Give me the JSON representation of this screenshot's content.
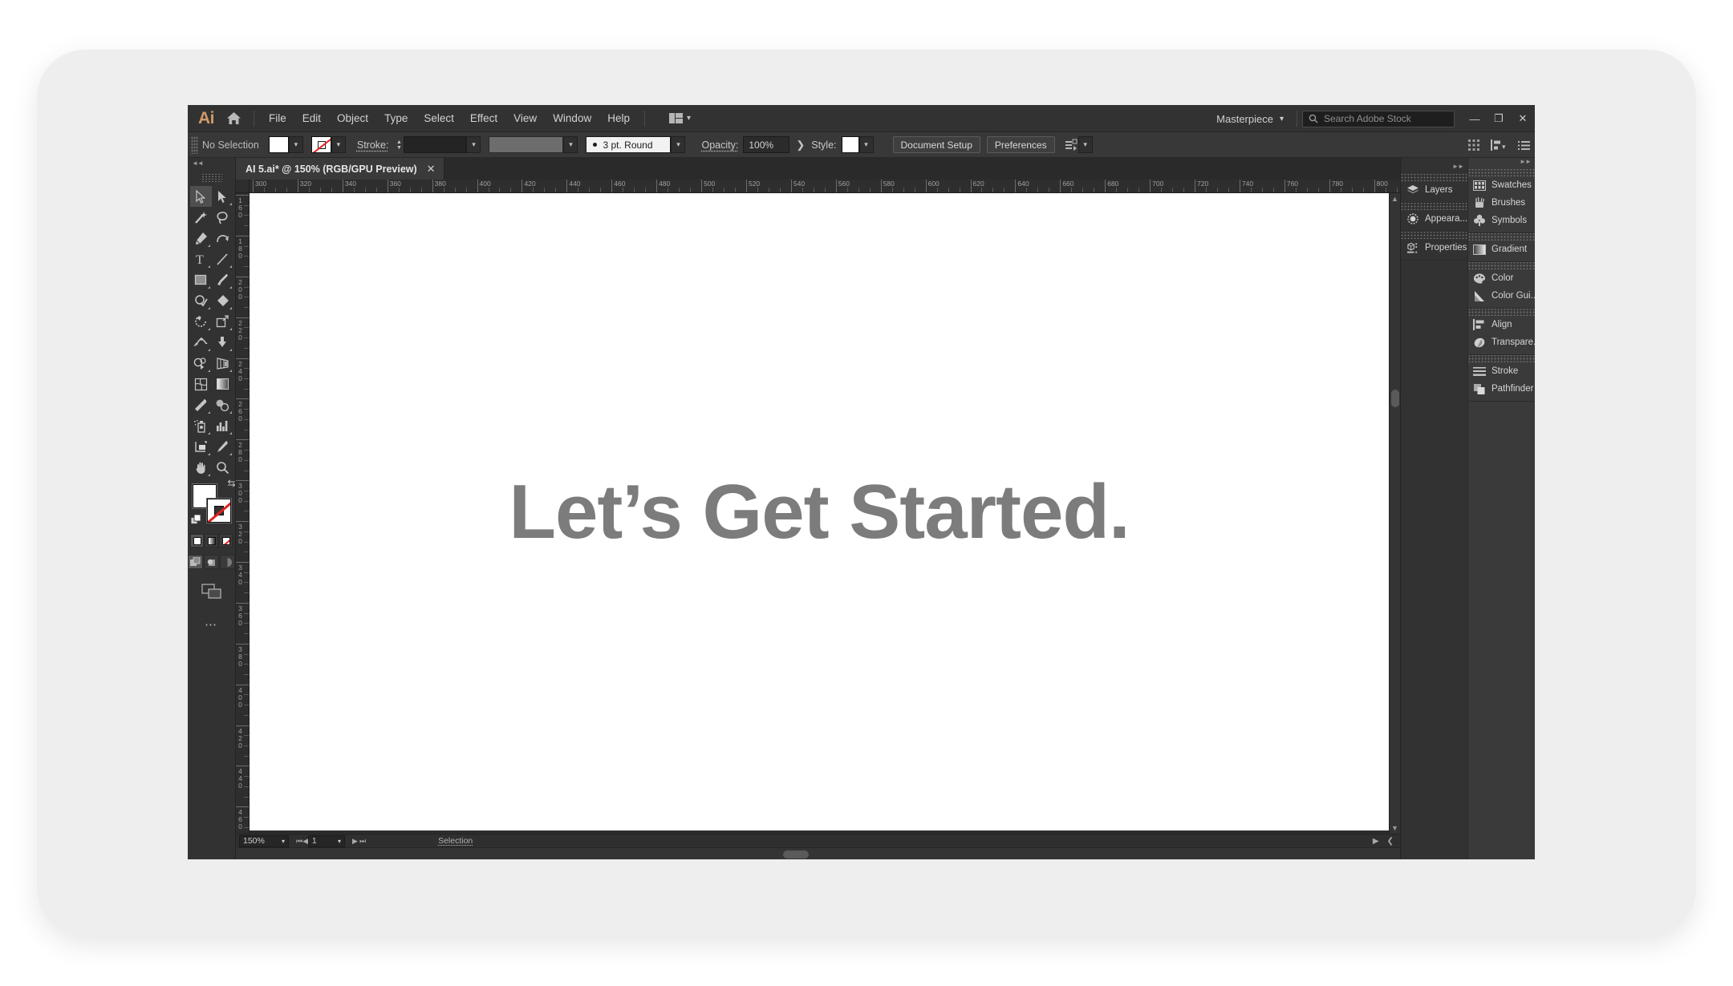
{
  "app": {
    "logo": "Ai",
    "menus": [
      "File",
      "Edit",
      "Object",
      "Type",
      "Select",
      "Effect",
      "View",
      "Window",
      "Help"
    ],
    "workspace": "Masterpiece",
    "search_placeholder": "Search Adobe Stock",
    "window_buttons": {
      "minimize": "—",
      "restore": "❐",
      "close": "✕"
    }
  },
  "control_bar": {
    "selection_status": "No Selection",
    "fill_label": "Fill",
    "stroke_label": "Stroke:",
    "stroke_weight": "",
    "brush_profile": "3 pt. Round",
    "opacity_label": "Opacity:",
    "opacity_value": "100%",
    "style_label": "Style:",
    "document_setup": "Document Setup",
    "preferences": "Preferences"
  },
  "tools": [
    {
      "name": "selection-tool",
      "label": "Selection"
    },
    {
      "name": "direct-selection-tool",
      "label": "Direct Selection"
    },
    {
      "name": "magic-wand-tool",
      "label": "Magic Wand"
    },
    {
      "name": "lasso-tool",
      "label": "Lasso"
    },
    {
      "name": "pen-tool",
      "label": "Pen"
    },
    {
      "name": "curvature-tool",
      "label": "Curvature"
    },
    {
      "name": "type-tool",
      "label": "Type"
    },
    {
      "name": "line-segment-tool",
      "label": "Line Segment"
    },
    {
      "name": "rectangle-tool",
      "label": "Rectangle"
    },
    {
      "name": "paintbrush-tool",
      "label": "Paintbrush"
    },
    {
      "name": "shaper-tool",
      "label": "Shaper"
    },
    {
      "name": "eraser-tool",
      "label": "Eraser"
    },
    {
      "name": "rotate-tool",
      "label": "Rotate"
    },
    {
      "name": "scale-tool",
      "label": "Scale"
    },
    {
      "name": "width-tool",
      "label": "Width"
    },
    {
      "name": "free-transform-tool",
      "label": "Free Transform"
    },
    {
      "name": "shape-builder-tool",
      "label": "Shape Builder"
    },
    {
      "name": "perspective-grid-tool",
      "label": "Perspective Grid"
    },
    {
      "name": "mesh-tool",
      "label": "Mesh"
    },
    {
      "name": "gradient-tool",
      "label": "Gradient"
    },
    {
      "name": "eyedropper-tool",
      "label": "Eyedropper"
    },
    {
      "name": "blend-tool",
      "label": "Blend"
    },
    {
      "name": "symbol-sprayer-tool",
      "label": "Symbol Sprayer"
    },
    {
      "name": "column-graph-tool",
      "label": "Column Graph"
    },
    {
      "name": "artboard-tool",
      "label": "Artboard"
    },
    {
      "name": "slice-tool",
      "label": "Slice"
    },
    {
      "name": "hand-tool",
      "label": "Hand"
    },
    {
      "name": "zoom-tool",
      "label": "Zoom"
    }
  ],
  "document": {
    "tab_title": "AI 5.ai* @ 150% (RGB/GPU Preview)",
    "close_label": "✕",
    "artboard_text": "Let’s Get Started.",
    "artboard_text_color": "#7c7c7c"
  },
  "rulers": {
    "horizontal": [
      300,
      320,
      340,
      360,
      380,
      400,
      420,
      440,
      460,
      480,
      500,
      520,
      540,
      560,
      580,
      600,
      620,
      640,
      660,
      680,
      700,
      720,
      740,
      760,
      780,
      800
    ],
    "vertical": [
      160,
      180,
      200,
      220,
      240,
      260,
      280,
      300,
      320,
      340,
      360,
      380,
      400,
      420,
      440,
      460
    ]
  },
  "status_bar": {
    "zoom": "150%",
    "page": "1",
    "tool_indicator": "Selection"
  },
  "panels_primary": [
    {
      "group": 0,
      "label": "Layers",
      "icon": "layers-icon"
    },
    {
      "group": 1,
      "label": "Appeara...",
      "icon": "appearance-icon"
    },
    {
      "group": 2,
      "label": "Properties",
      "icon": "properties-icon"
    }
  ],
  "panels_secondary": [
    {
      "group": 0,
      "label": "Swatches",
      "icon": "swatches-icon"
    },
    {
      "group": 0,
      "label": "Brushes",
      "icon": "brushes-icon"
    },
    {
      "group": 0,
      "label": "Symbols",
      "icon": "symbols-icon"
    },
    {
      "group": 1,
      "label": "Gradient",
      "icon": "gradient-icon"
    },
    {
      "group": 2,
      "label": "Color",
      "icon": "color-icon"
    },
    {
      "group": 2,
      "label": "Color Gui...",
      "icon": "color-guide-icon"
    },
    {
      "group": 3,
      "label": "Align",
      "icon": "align-icon"
    },
    {
      "group": 3,
      "label": "Transpare...",
      "icon": "transparency-icon"
    },
    {
      "group": 4,
      "label": "Stroke",
      "icon": "stroke-icon"
    },
    {
      "group": 4,
      "label": "Pathfinder",
      "icon": "pathfinder-icon"
    }
  ],
  "colors": {
    "brand_orange": "#d09a6a",
    "window_chrome": "#323232",
    "panel_bg": "#3a3a3a",
    "canvas": "#ffffff",
    "none_slash": "#e02020"
  }
}
